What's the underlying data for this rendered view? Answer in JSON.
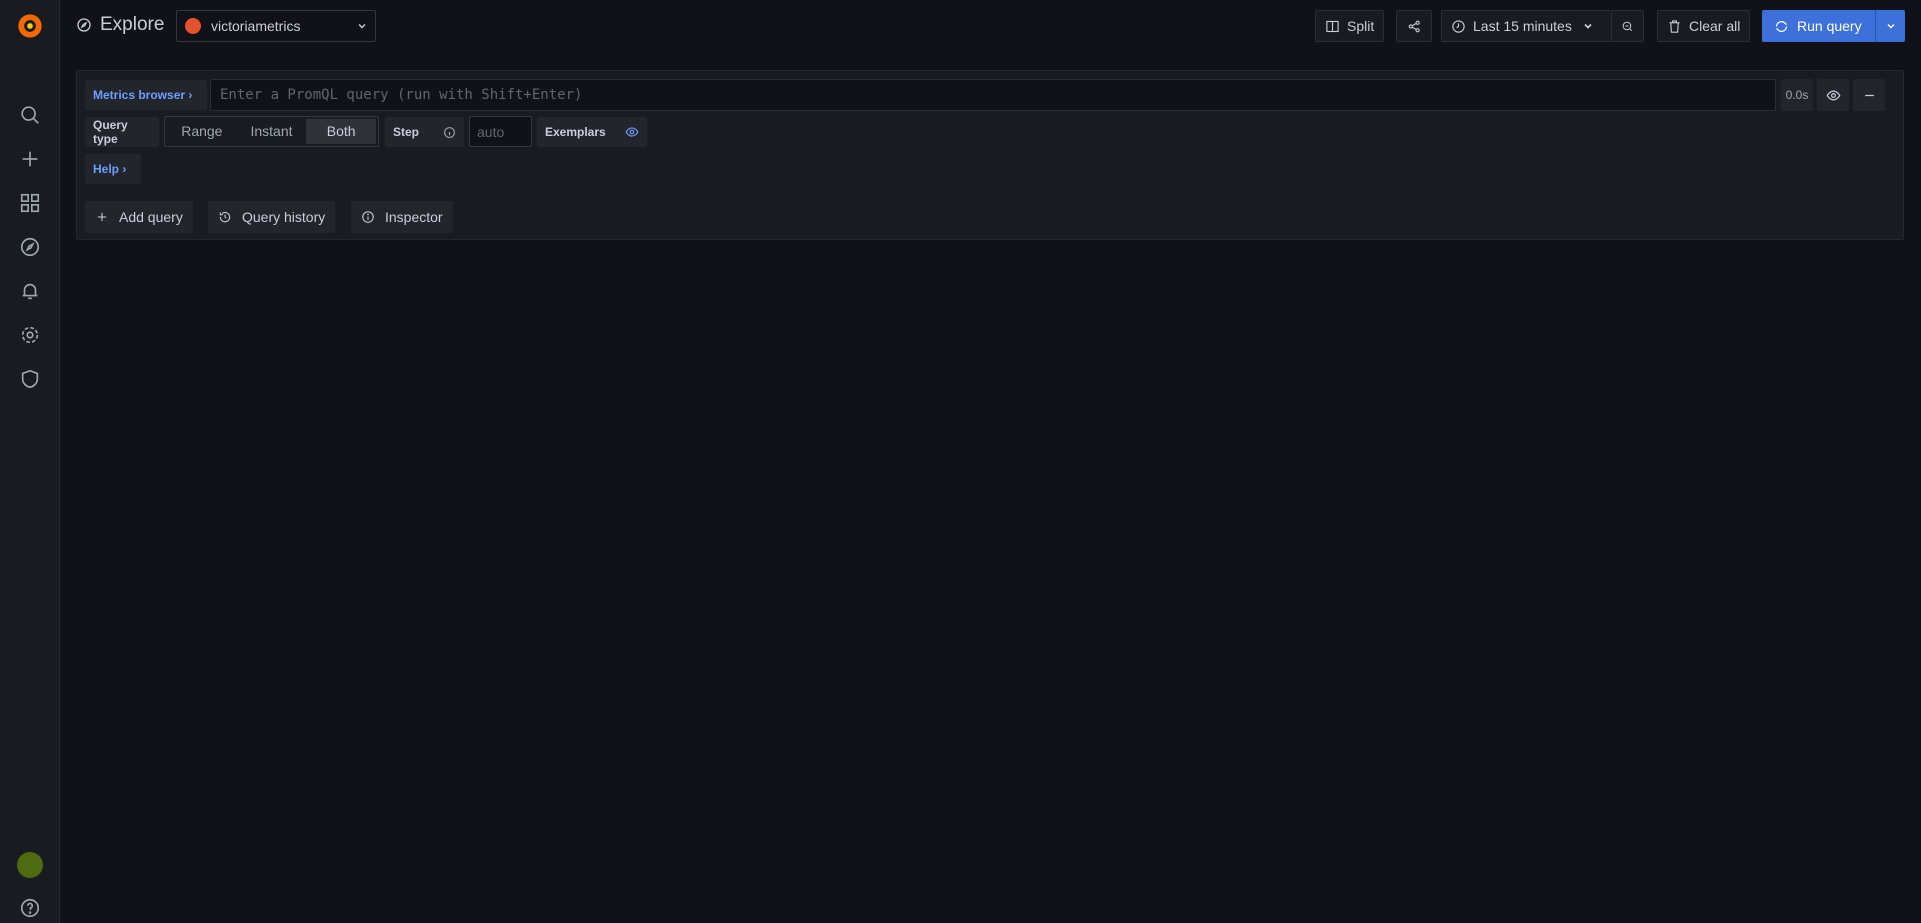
{
  "header": {
    "title": "Explore",
    "datasource": "victoriametrics",
    "split_label": "Split",
    "time_range": "Last 15 minutes",
    "clear_all_label": "Clear all",
    "run_query_label": "Run query"
  },
  "query": {
    "metrics_browser_label": "Metrics browser",
    "placeholder": "Enter a PromQL query (run with Shift+Enter)",
    "value": "",
    "duration": "0.0s",
    "query_type_label": "Query type",
    "query_type_options": [
      "Range",
      "Instant",
      "Both"
    ],
    "query_type_selected": "Both",
    "step_label": "Step",
    "step_placeholder": "auto",
    "exemplars_label": "Exemplars",
    "help_label": "Help"
  },
  "actions": {
    "add_query": "Add query",
    "query_history": "Query history",
    "inspector": "Inspector"
  },
  "sidebar": {
    "items": [
      "search",
      "create",
      "dashboards",
      "explore",
      "alerting",
      "configuration",
      "server-admin"
    ]
  },
  "colors": {
    "accent": "#3d71d9",
    "link": "#6e9fff"
  }
}
